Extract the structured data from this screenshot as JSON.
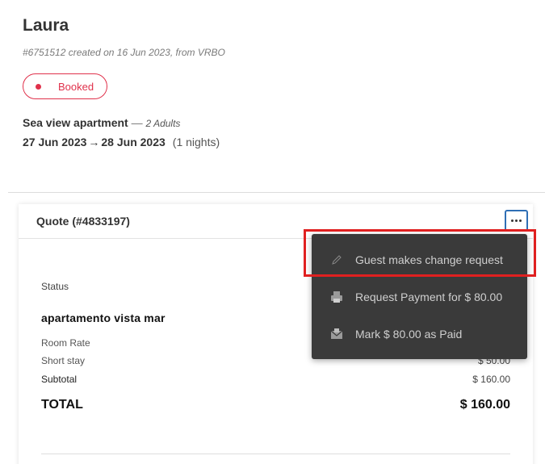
{
  "booking": {
    "guest_name": "Laura",
    "meta": "#6751512 created on 16 Jun 2023, from VRBO",
    "status": "Booked",
    "property": "Sea view apartment",
    "separator": " — ",
    "guests": "2 Adults",
    "check_in": "27 Jun 2023",
    "arrow": "→",
    "check_out": "28 Jun 2023",
    "nights": "(1 nights)"
  },
  "quote": {
    "title": "Quote (#4833197)",
    "status_label": "Status",
    "rate_title": "apartamento vista mar",
    "rows": [
      {
        "label": "Room Rate",
        "value": ""
      },
      {
        "label": "Short stay",
        "value": "$ 50.00"
      },
      {
        "label": "Subtotal",
        "value": "$ 160.00"
      }
    ],
    "total_label": "TOTAL",
    "total_value": "$ 160.00"
  },
  "menu": {
    "items": [
      {
        "label": "Guest makes change request",
        "icon": "pencil-icon"
      },
      {
        "label": "Request Payment for $ 80.00",
        "icon": "printer-icon"
      },
      {
        "label": "Mark $ 80.00 as Paid",
        "icon": "envelope-icon"
      }
    ]
  },
  "colors": {
    "accent_red": "#e0314b",
    "menu_bg": "#3a3a3a",
    "focus_blue": "#2f6fb5",
    "highlight_red": "#e02020"
  }
}
